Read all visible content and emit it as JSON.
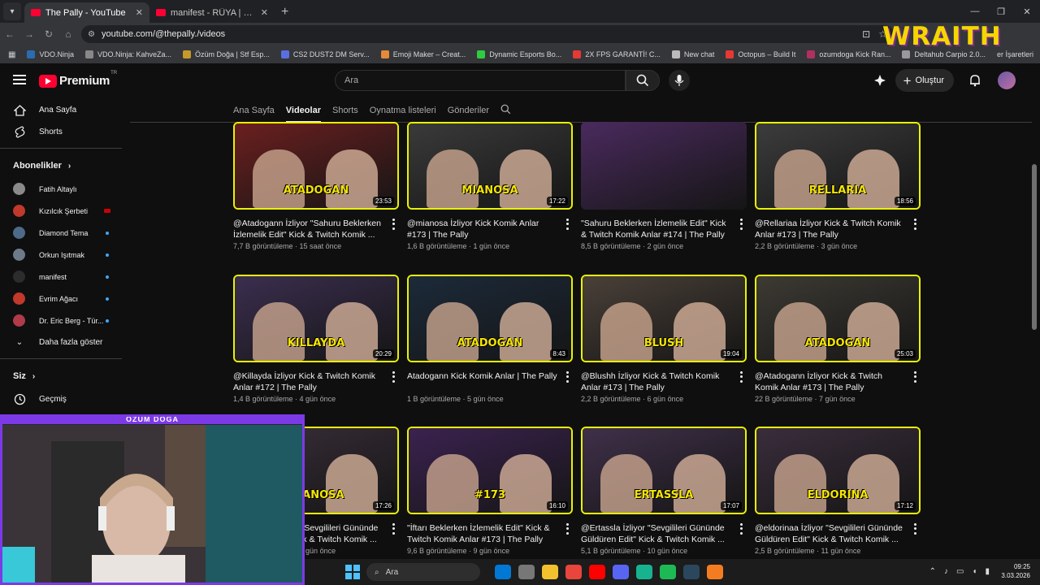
{
  "browser": {
    "tabs": [
      {
        "title": "The Pally - YouTube",
        "active": true
      },
      {
        "title": "manifest - RÜYA | Special Dance...",
        "active": false
      }
    ],
    "url": "youtube.com/@thepally./videos",
    "bookmarks": [
      {
        "label": "VDO.Ninja",
        "color": "#2b6cb0"
      },
      {
        "label": "VDO.Ninja: KahveZa...",
        "color": "#888888"
      },
      {
        "label": "Özüm Doğa | Stf Esp...",
        "color": "#c49a2a"
      },
      {
        "label": "CS2 DUST2 DM Serv...",
        "color": "#5b6ee1"
      },
      {
        "label": "Emoji Maker – Creat...",
        "color": "#e58a3a"
      },
      {
        "label": "Dynamic Esports Bo...",
        "color": "#2ecc40"
      },
      {
        "label": "2X FPS GARANTİ! C...",
        "color": "#e53935"
      },
      {
        "label": "New chat",
        "color": "#bbbbbb"
      },
      {
        "label": "Octopus – Build It",
        "color": "#e53935"
      },
      {
        "label": "ozumdoga Kick Ran...",
        "color": "#b03060"
      },
      {
        "label": "Deltahub Carpio 2.0...",
        "color": "#999999"
      }
    ],
    "bookmarks_end": "er İşaretleri",
    "overlay_brand": "WRAITH"
  },
  "youtube": {
    "brand": "Premium",
    "brand_suffix": "TR",
    "search_placeholder": "Ara",
    "create_label": "Oluştur",
    "sidebar": {
      "top": [
        {
          "label": "Ana Sayfa",
          "icon": "home-icon"
        },
        {
          "label": "Shorts",
          "icon": "shorts-icon"
        }
      ],
      "subs_heading": "Abonelikler",
      "subs": [
        {
          "name": "Fatih Altaylı",
          "color": "#8a8a8a",
          "badge": "none"
        },
        {
          "name": "Kızılcık Şerbeti",
          "color": "#c0392b",
          "badge": "live"
        },
        {
          "name": "Diamond Tema",
          "color": "#4d6b88",
          "badge": "dot"
        },
        {
          "name": "Orkun Işıtmak",
          "color": "#6c7a89",
          "badge": "dot"
        },
        {
          "name": "manifest",
          "color": "#2c2c2c",
          "badge": "dot"
        },
        {
          "name": "Evrim Ağacı",
          "color": "#c0392b",
          "badge": "dot"
        },
        {
          "name": "Dr. Eric Berg - Tür...",
          "color": "#b03a48",
          "badge": "dot"
        }
      ],
      "show_more": "Daha fazla göster",
      "you_heading": "Siz",
      "history": "Geçmiş"
    },
    "channel_tabs": [
      "Ana Sayfa",
      "Videolar",
      "Shorts",
      "Oynatma listeleri",
      "Gönderiler"
    ],
    "videos": [
      {
        "title": "@Atadogann İzliyor \"Sahuru Beklerken İzlemelik Edit\" Kick & Twitch Komik ...",
        "meta": "7,7 B görüntüleme · 15 saat önce",
        "duration": "23:53",
        "caption": "ATADOGAN",
        "bg": "#6b1f1f"
      },
      {
        "title": "@mianosa İzliyor Kick Komik Anlar #173 | The Pally",
        "meta": "1,6 B görüntüleme · 1 gün önce",
        "duration": "17:22",
        "caption": "MIANOSA",
        "bg": "#3a3a3a"
      },
      {
        "title": "\"Sahuru Beklerken İzlemelik Edit\" Kick & Twitch Komik Anlar #174 | The Pally",
        "meta": "8,5 B görüntüleme · 2 gün önce",
        "duration": "",
        "caption": "",
        "bg": "#4a2a5e"
      },
      {
        "title": "@Rellariaa İzliyor Kick & Twitch Komik Anlar #173 | The Pally",
        "meta": "2,2 B görüntüleme · 3 gün önce",
        "duration": "18:56",
        "caption": "RELLARIA",
        "bg": "#3c3c3c"
      },
      {
        "title": "@Killayda İzliyor Kick & Twitch Komik Anlar #172 | The Pally",
        "meta": "1,4 B görüntüleme · 4 gün önce",
        "duration": "20:29",
        "caption": "KILLAYDA",
        "bg": "#3b2e4f"
      },
      {
        "title": "Atadogann Kick Komik Anlar | The Pally",
        "meta": "1 B görüntüleme · 5 gün önce",
        "duration": "8:43",
        "caption": "ATADOGAN",
        "bg": "#1c2a3a"
      },
      {
        "title": "@Blushh İzliyor Kick & Twitch Komik Anlar #173 | The Pally",
        "meta": "2,2 B görüntüleme · 6 gün önce",
        "duration": "19:04",
        "caption": "BLUSH",
        "bg": "#4a4038"
      },
      {
        "title": "@Atadogann İzliyor Kick & Twitch Komik Anlar #173 | The Pally",
        "meta": "22 B görüntüleme · 7 gün önce",
        "duration": "25:03",
        "caption": "ATADOGAN",
        "bg": "#3d3a33"
      },
      {
        "title": "@mianosa İzliyor \"Sevgilileri Gününde Güldüren Edit\" Kick & Twitch Komik ...",
        "meta": "1,4 B görüntüleme · 8 gün önce",
        "duration": "17:26",
        "caption": "MIANOSA",
        "bg": "#3a2f3a"
      },
      {
        "title": "\"İftarı Beklerken İzlemelik Edit\" Kick & Twitch Komik Anlar #173 | The Pally",
        "meta": "9,6 B görüntüleme · 9 gün önce",
        "duration": "16:10",
        "caption": "#173",
        "bg": "#3b2250"
      },
      {
        "title": "@Ertassla İzliyor \"Sevgilileri Gününde Güldüren Edit\" Kick & Twitch Komik ...",
        "meta": "5,1 B görüntüleme · 10 gün önce",
        "duration": "17:07",
        "caption": "ERTASSLA",
        "bg": "#40304a"
      },
      {
        "title": "@eldorinaa İzliyor \"Sevgilileri Gününde Güldüren Edit\" Kick & Twitch Komik ...",
        "meta": "2,5 B görüntüleme · 11 gün önce",
        "duration": "17:12",
        "caption": "ELDORINA",
        "bg": "#3a2d3c"
      }
    ]
  },
  "webcam": {
    "label": "ÖZÜM DOĞA"
  },
  "taskbar": {
    "search": "Ara",
    "apps": [
      "#0078d4",
      "#777777",
      "#f2c12e",
      "#e8453c",
      "#ff0000",
      "#5865f2",
      "#17b38f",
      "#1db954",
      "#2a475e",
      "#f47c20"
    ],
    "time": "09:25",
    "date": "3.03.2026"
  }
}
